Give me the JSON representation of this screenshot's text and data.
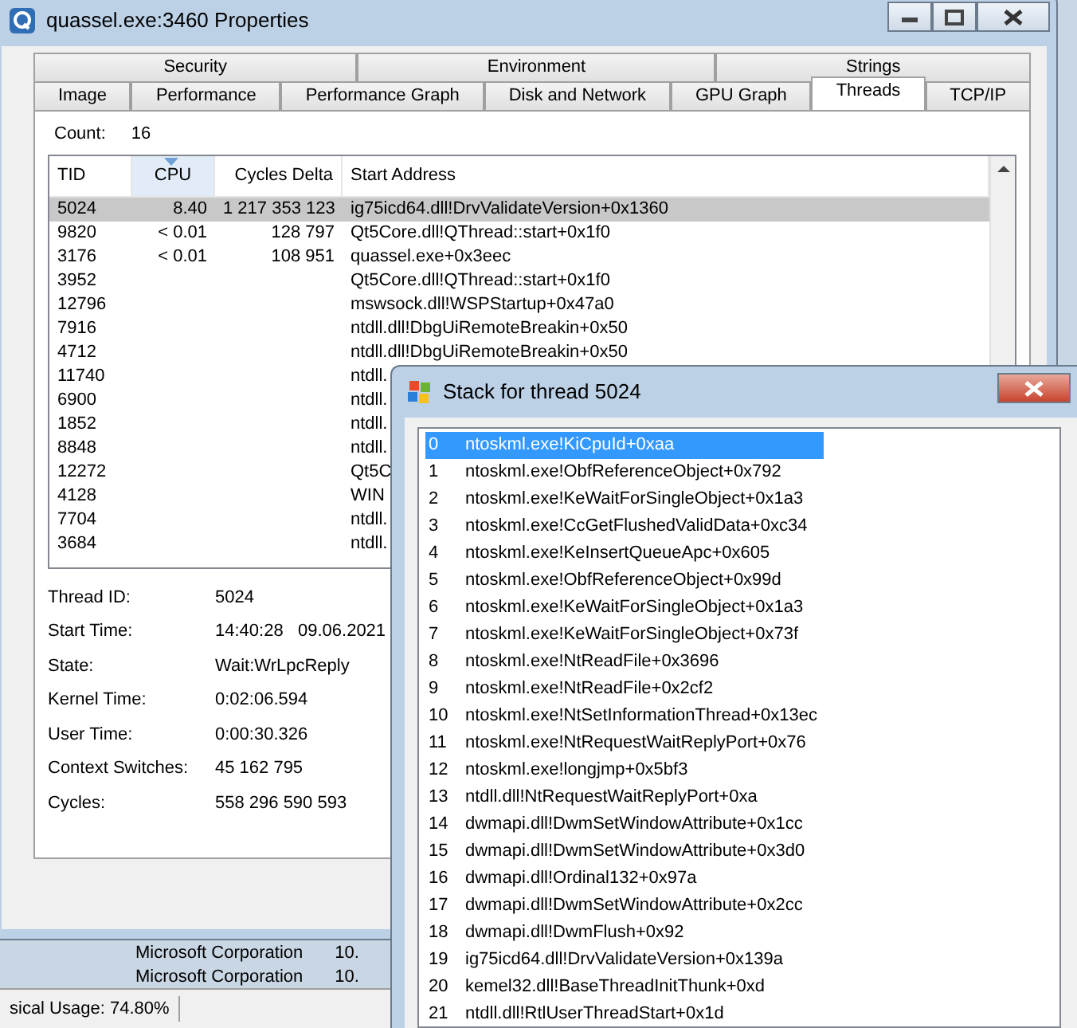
{
  "window": {
    "title": "quassel.exe:3460 Properties"
  },
  "tab_rows": [
    {
      "tabs": [
        {
          "label": "Security",
          "selected": false
        },
        {
          "label": "Environment",
          "selected": false
        },
        {
          "label": "Strings",
          "selected": false
        }
      ]
    },
    {
      "tabs": [
        {
          "label": "Image",
          "selected": false
        },
        {
          "label": "Performance",
          "selected": false
        },
        {
          "label": "Performance Graph",
          "selected": false
        },
        {
          "label": "Disk and Network",
          "selected": false
        },
        {
          "label": "GPU Graph",
          "selected": false
        },
        {
          "label": "Threads",
          "selected": true
        },
        {
          "label": "TCP/IP",
          "selected": false
        }
      ]
    }
  ],
  "count": {
    "label": "Count:",
    "value": "16"
  },
  "threads": {
    "columns": [
      {
        "label": "TID",
        "sorted": false
      },
      {
        "label": "CPU",
        "sorted": true
      },
      {
        "label": "Cycles Delta",
        "sorted": false
      },
      {
        "label": "Start Address",
        "sorted": false
      }
    ],
    "rows": [
      {
        "tid": "5024",
        "cpu": "8.40",
        "cycles_delta": "1 217 353 123",
        "start_address": "ig75icd64.dll!DrvValidateVersion+0x1360",
        "selected": true
      },
      {
        "tid": "9820",
        "cpu": "< 0.01",
        "cycles_delta": "128 797",
        "start_address": "Qt5Core.dll!QThread::start+0x1f0",
        "selected": false
      },
      {
        "tid": "3176",
        "cpu": "< 0.01",
        "cycles_delta": "108 951",
        "start_address": "quassel.exe+0x3eec",
        "selected": false
      },
      {
        "tid": "3952",
        "start_address": "Qt5Core.dll!QThread::start+0x1f0",
        "selected": false
      },
      {
        "tid": "12796",
        "start_address": "mswsock.dll!WSPStartup+0x47a0",
        "selected": false
      },
      {
        "tid": "7916",
        "start_address": "ntdll.dll!DbgUiRemoteBreakin+0x50",
        "selected": false
      },
      {
        "tid": "4712",
        "start_address": "ntdll.dll!DbgUiRemoteBreakin+0x50",
        "selected": false
      },
      {
        "tid": "11740",
        "start_address": "ntdll.",
        "selected": false
      },
      {
        "tid": "6900",
        "start_address": "ntdll.",
        "selected": false
      },
      {
        "tid": "1852",
        "start_address": "ntdll.",
        "selected": false
      },
      {
        "tid": "8848",
        "start_address": "ntdll.",
        "selected": false
      },
      {
        "tid": "12272",
        "start_address": "Qt5C",
        "selected": false
      },
      {
        "tid": "4128",
        "start_address": "WIN",
        "selected": false
      },
      {
        "tid": "7704",
        "start_address": "ntdll.",
        "selected": false
      },
      {
        "tid": "3684",
        "start_address": "ntdll.",
        "selected": false
      }
    ]
  },
  "details": [
    {
      "label": "Thread ID:",
      "value": "5024"
    },
    {
      "label": "Start Time:",
      "value": "14:40:28   09.06.2021"
    },
    {
      "label": "State:",
      "value": "Wait:WrLpcReply"
    },
    {
      "label": "Kernel Time:",
      "value": "0:02:06.594"
    },
    {
      "label": "User Time:",
      "value": "0:00:30.326"
    },
    {
      "label": "Context Switches:",
      "value": "45 162 795"
    },
    {
      "label": "Cycles:",
      "value": "558 296 590 593"
    }
  ],
  "background": {
    "rows": [
      {
        "company": "Microsoft Corporation",
        "version": "10."
      },
      {
        "company": "Microsoft Corporation",
        "version": "10."
      }
    ],
    "status": "sical Usage: 74.80%"
  },
  "stack": {
    "title": "Stack for thread 5024",
    "frames": [
      {
        "index": "0",
        "address": "ntoskml.exe!KiCpuId+0xaa",
        "selected": true
      },
      {
        "index": "1",
        "address": "ntoskml.exe!ObfReferenceObject+0x792",
        "selected": false
      },
      {
        "index": "2",
        "address": "ntoskml.exe!KeWaitForSingleObject+0x1a3",
        "selected": false
      },
      {
        "index": "3",
        "address": "ntoskml.exe!CcGetFlushedValidData+0xc34",
        "selected": false
      },
      {
        "index": "4",
        "address": "ntoskml.exe!KeInsertQueueApc+0x605",
        "selected": false
      },
      {
        "index": "5",
        "address": "ntoskml.exe!ObfReferenceObject+0x99d",
        "selected": false
      },
      {
        "index": "6",
        "address": "ntoskml.exe!KeWaitForSingleObject+0x1a3",
        "selected": false
      },
      {
        "index": "7",
        "address": "ntoskml.exe!KeWaitForSingleObject+0x73f",
        "selected": false
      },
      {
        "index": "8",
        "address": "ntoskml.exe!NtReadFile+0x3696",
        "selected": false
      },
      {
        "index": "9",
        "address": "ntoskml.exe!NtReadFile+0x2cf2",
        "selected": false
      },
      {
        "index": "10",
        "address": "ntoskml.exe!NtSetInformationThread+0x13ec",
        "selected": false
      },
      {
        "index": "11",
        "address": "ntoskml.exe!NtRequestWaitReplyPort+0x76",
        "selected": false
      },
      {
        "index": "12",
        "address": "ntoskml.exe!longjmp+0x5bf3",
        "selected": false
      },
      {
        "index": "13",
        "address": "ntdll.dll!NtRequestWaitReplyPort+0xa",
        "selected": false
      },
      {
        "index": "14",
        "address": "dwmapi.dll!DwmSetWindowAttribute+0x1cc",
        "selected": false
      },
      {
        "index": "15",
        "address": "dwmapi.dll!DwmSetWindowAttribute+0x3d0",
        "selected": false
      },
      {
        "index": "16",
        "address": "dwmapi.dll!Ordinal132+0x97a",
        "selected": false
      },
      {
        "index": "17",
        "address": "dwmapi.dll!DwmSetWindowAttribute+0x2cc",
        "selected": false
      },
      {
        "index": "18",
        "address": "dwmapi.dll!DwmFlush+0x92",
        "selected": false
      },
      {
        "index": "19",
        "address": "ig75icd64.dll!DrvValidateVersion+0x139a",
        "selected": false
      },
      {
        "index": "20",
        "address": "kemel32.dll!BaseThreadInitThunk+0xd",
        "selected": false
      },
      {
        "index": "21",
        "address": "ntdll.dll!RtlUserThreadStart+0x1d",
        "selected": false
      }
    ]
  }
}
